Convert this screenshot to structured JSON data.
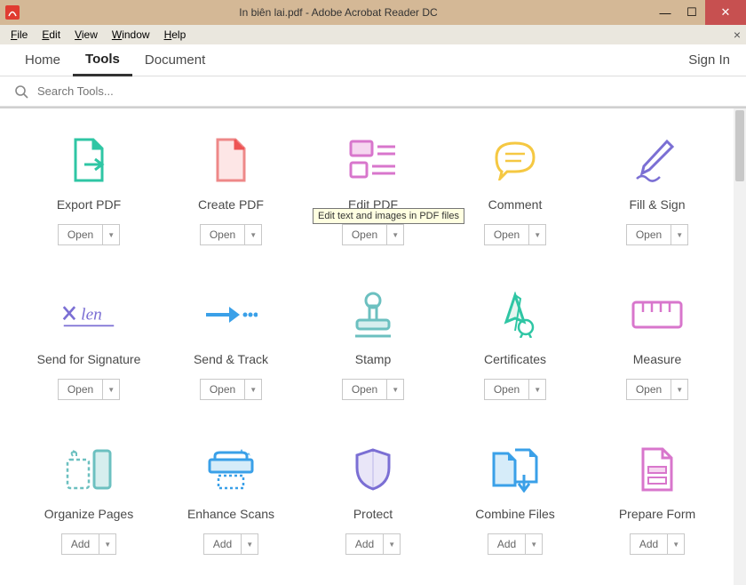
{
  "window": {
    "title": "In biên lai.pdf - Adobe Acrobat Reader DC"
  },
  "menubar": {
    "items": [
      "File",
      "Edit",
      "View",
      "Window",
      "Help"
    ]
  },
  "tabbar": {
    "home": "Home",
    "tools": "Tools",
    "document": "Document",
    "signin": "Sign In"
  },
  "search": {
    "placeholder": "Search Tools..."
  },
  "buttons": {
    "open": "Open",
    "add": "Add"
  },
  "tooltip": {
    "edit_pdf": "Edit text and images in PDF files"
  },
  "tools": {
    "row1": [
      {
        "label": "Export PDF",
        "button": "open"
      },
      {
        "label": "Create PDF",
        "button": "open"
      },
      {
        "label": "Edit PDF",
        "button": "open"
      },
      {
        "label": "Comment",
        "button": "open"
      },
      {
        "label": "Fill & Sign",
        "button": "open"
      }
    ],
    "row2": [
      {
        "label": "Send for Signature",
        "button": "open"
      },
      {
        "label": "Send & Track",
        "button": "open"
      },
      {
        "label": "Stamp",
        "button": "open"
      },
      {
        "label": "Certificates",
        "button": "open"
      },
      {
        "label": "Measure",
        "button": "open"
      }
    ],
    "row3": [
      {
        "label": "Organize Pages",
        "button": "add"
      },
      {
        "label": "Enhance Scans",
        "button": "add"
      },
      {
        "label": "Protect",
        "button": "add"
      },
      {
        "label": "Combine Files",
        "button": "add"
      },
      {
        "label": "Prepare Form",
        "button": "add"
      }
    ]
  }
}
